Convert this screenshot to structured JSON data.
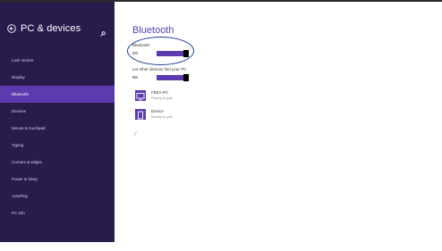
{
  "sidebar": {
    "title": "PC & devices",
    "items": [
      {
        "label": "Lock screen"
      },
      {
        "label": "Display"
      },
      {
        "label": "Bluetooth",
        "active": true
      },
      {
        "label": "Devices"
      },
      {
        "label": "Mouse & touchpad"
      },
      {
        "label": "Typing"
      },
      {
        "label": "Corners & edges"
      },
      {
        "label": "Power & sleep"
      },
      {
        "label": "AutoPlay"
      },
      {
        "label": "PC info"
      }
    ]
  },
  "main": {
    "title": "Bluetooth",
    "bluetooth": {
      "label": "Bluetooth",
      "state": "On",
      "value": true
    },
    "discover": {
      "label": "Let other devices find your PC",
      "state": "On",
      "value": true
    },
    "devices": [
      {
        "name": "FBZA-PC",
        "status": "Ready to pair",
        "icon": "computer-icon"
      },
      {
        "name": "Device",
        "status": "Ready to pair",
        "icon": "tablet-icon"
      }
    ],
    "loading_glyph": "⁄"
  },
  "colors": {
    "sidebar_bg": "#2a1b4d",
    "accent": "#5c3bb0",
    "annotation": "#1a3f92"
  }
}
